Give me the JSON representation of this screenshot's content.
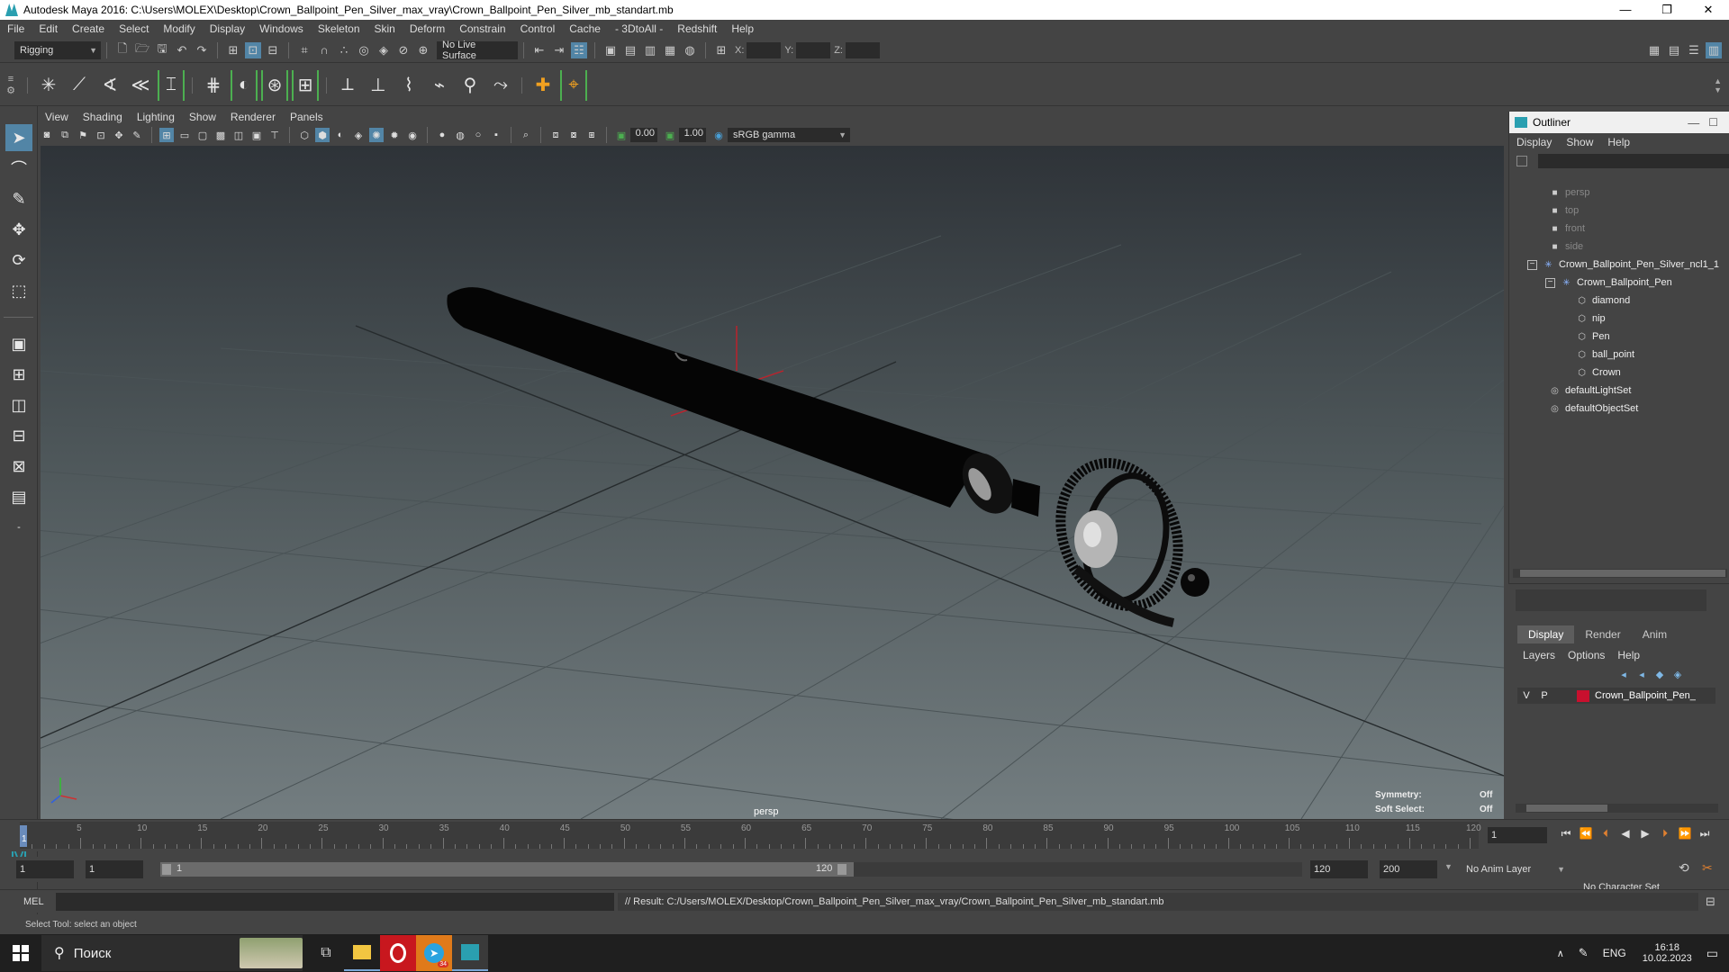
{
  "window": {
    "title": "Autodesk Maya 2016: C:\\Users\\MOLEX\\Desktop\\Crown_Ballpoint_Pen_Silver_max_vray\\Crown_Ballpoint_Pen_Silver_mb_standart.mb",
    "min": "—",
    "max": "❐",
    "close": "✕"
  },
  "menubar": [
    "File",
    "Edit",
    "Create",
    "Select",
    "Modify",
    "Display",
    "Windows",
    "Skeleton",
    "Skin",
    "Deform",
    "Constrain",
    "Control",
    "Cache",
    "- 3DtoAll -",
    "Redshift",
    "Help"
  ],
  "statusline": {
    "menu_set": "Rigging",
    "live_surface": "No Live Surface",
    "x_label": "X:",
    "y_label": "Y:",
    "z_label": "Z:"
  },
  "viewport": {
    "menu": [
      "View",
      "Shading",
      "Lighting",
      "Show",
      "Renderer",
      "Panels"
    ],
    "exposure": "0.00",
    "gamma": "1.00",
    "color_space": "sRGB gamma",
    "camera_label": "persp",
    "hud": {
      "symmetry_label": "Symmetry:",
      "symmetry_value": "Off",
      "soft_select_label": "Soft Select:",
      "soft_select_value": "Off"
    }
  },
  "outliner": {
    "title": "Outliner",
    "menu": [
      "Display",
      "Show",
      "Help"
    ],
    "items": [
      {
        "label": "persp",
        "depth": 0,
        "dim": true,
        "icon": "camera-icon"
      },
      {
        "label": "top",
        "depth": 0,
        "dim": true,
        "icon": "camera-icon"
      },
      {
        "label": "front",
        "depth": 0,
        "dim": true,
        "icon": "camera-icon"
      },
      {
        "label": "side",
        "depth": 0,
        "dim": true,
        "icon": "camera-icon"
      },
      {
        "label": "Crown_Ballpoint_Pen_Silver_ncl1_1",
        "depth": 0,
        "dim": false,
        "icon": "group-icon"
      },
      {
        "label": "Crown_Ballpoint_Pen",
        "depth": 1,
        "dim": false,
        "icon": "group-icon"
      },
      {
        "label": "diamond",
        "depth": 2,
        "dim": false,
        "icon": "mesh-icon"
      },
      {
        "label": "nip",
        "depth": 2,
        "dim": false,
        "icon": "mesh-icon"
      },
      {
        "label": "Pen",
        "depth": 2,
        "dim": false,
        "icon": "mesh-icon"
      },
      {
        "label": "ball_point",
        "depth": 2,
        "dim": false,
        "icon": "mesh-icon"
      },
      {
        "label": "Crown",
        "depth": 2,
        "dim": false,
        "icon": "mesh-icon"
      },
      {
        "label": "defaultLightSet",
        "depth": 0,
        "dim": false,
        "icon": "set-icon"
      },
      {
        "label": "defaultObjectSet",
        "depth": 0,
        "dim": false,
        "icon": "set-icon"
      }
    ]
  },
  "layers": {
    "tabs": [
      "Display",
      "Render",
      "Anim"
    ],
    "menu": [
      "Layers",
      "Options",
      "Help"
    ],
    "row": {
      "v": "V",
      "p": "P",
      "name": "Crown_Ballpoint_Pen_",
      "color": "#c8102e"
    }
  },
  "timeline": {
    "ticks": [
      "5",
      "10",
      "15",
      "20",
      "25",
      "30",
      "35",
      "40",
      "45",
      "50",
      "55",
      "60",
      "65",
      "70",
      "75",
      "80",
      "85",
      "90",
      "95",
      "100",
      "105",
      "110",
      "115",
      "120"
    ],
    "current_frame_marker": "1",
    "current_frame_field": "1"
  },
  "range": {
    "start": "1",
    "anim_start": "1",
    "slider_start": "1",
    "slider_end": "120",
    "end": "120",
    "anim_end": "200",
    "anim_layer": "No Anim Layer",
    "character_set": "No Character Set"
  },
  "mel": {
    "label": "MEL",
    "result": "// Result: C:/Users/MOLEX/Desktop/Crown_Ballpoint_Pen_Silver_max_vray/Crown_Ballpoint_Pen_Silver_mb_standart.mb"
  },
  "helpline": "Select Tool: select an object",
  "taskbar": {
    "search": "Поиск",
    "lang": "ENG",
    "time": "16:18",
    "date": "10.02.2023",
    "telegram_badge": "34"
  }
}
